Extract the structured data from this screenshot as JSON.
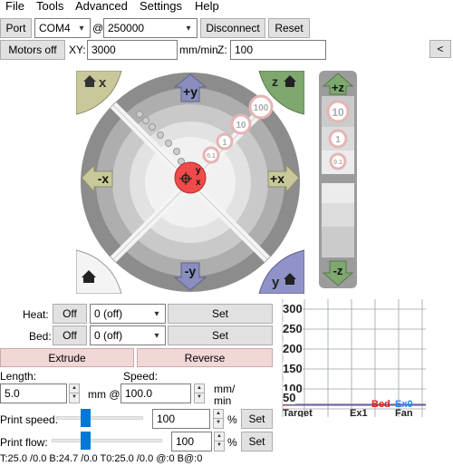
{
  "menu": [
    "File",
    "Tools",
    "Advanced",
    "Settings",
    "Help"
  ],
  "connection": {
    "port_label": "Port",
    "port_value": "COM4",
    "at": "@",
    "baud_value": "250000",
    "disconnect_label": "Disconnect",
    "reset_label": "Reset"
  },
  "motion": {
    "motors_off_label": "Motors off",
    "xy_label": "XY:",
    "xy_value": "3000",
    "xy_unit": "mm/min",
    "z_label": "Z:",
    "z_value": "100",
    "collapse_label": "<"
  },
  "jog": {
    "home_x": "x",
    "home_z": "z",
    "home_y": "y",
    "plus_y": "+y",
    "minus_y": "-y",
    "minus_x": "-x",
    "plus_x": "+x",
    "step_100": "100",
    "step_10": "10",
    "step_1": "1",
    "step_01": "0.1",
    "center_y": "y",
    "center_x": "x",
    "z_plus": "+z",
    "z_minus": "-z",
    "z_step_10": "10",
    "z_step_1": "1",
    "z_step_01": "0.1"
  },
  "temps": {
    "heat_label": "Heat:",
    "heat_off": "Off",
    "heat_value": "0 (off)",
    "heat_set": "Set",
    "bed_label": "Bed:",
    "bed_off": "Off",
    "bed_value": "0 (off)",
    "bed_set": "Set"
  },
  "extrude": {
    "extrude_label": "Extrude",
    "reverse_label": "Reverse",
    "length_label": "Length:",
    "length_value": "5.0",
    "mm_at": "mm @",
    "speed_label": "Speed:",
    "speed_value": "100.0",
    "speed_unit_1": "mm/",
    "speed_unit_2": "min"
  },
  "factors": {
    "print_speed_label": "Print speed:",
    "print_speed_value": "100",
    "print_speed_level": 0.2,
    "print_flow_label": "Print flow:",
    "print_flow_value": "100",
    "print_flow_level": 0.2,
    "percent": "%",
    "set_label": "Set"
  },
  "graph": {
    "y_ticks": [
      "300",
      "250",
      "200",
      "150",
      "100",
      "50"
    ],
    "bed_label": "Bed",
    "ex0_label": "Ex0",
    "target_label": "Target",
    "ex1_label": "Ex1",
    "fan_label": "Fan",
    "colors": {
      "bed": "#e0201f",
      "ex0": "#1e90ff"
    }
  },
  "status": "T:25.0 /0.0 B:24.7 /0.0 T0:25.0 /0.0 @:0 B@:0"
}
